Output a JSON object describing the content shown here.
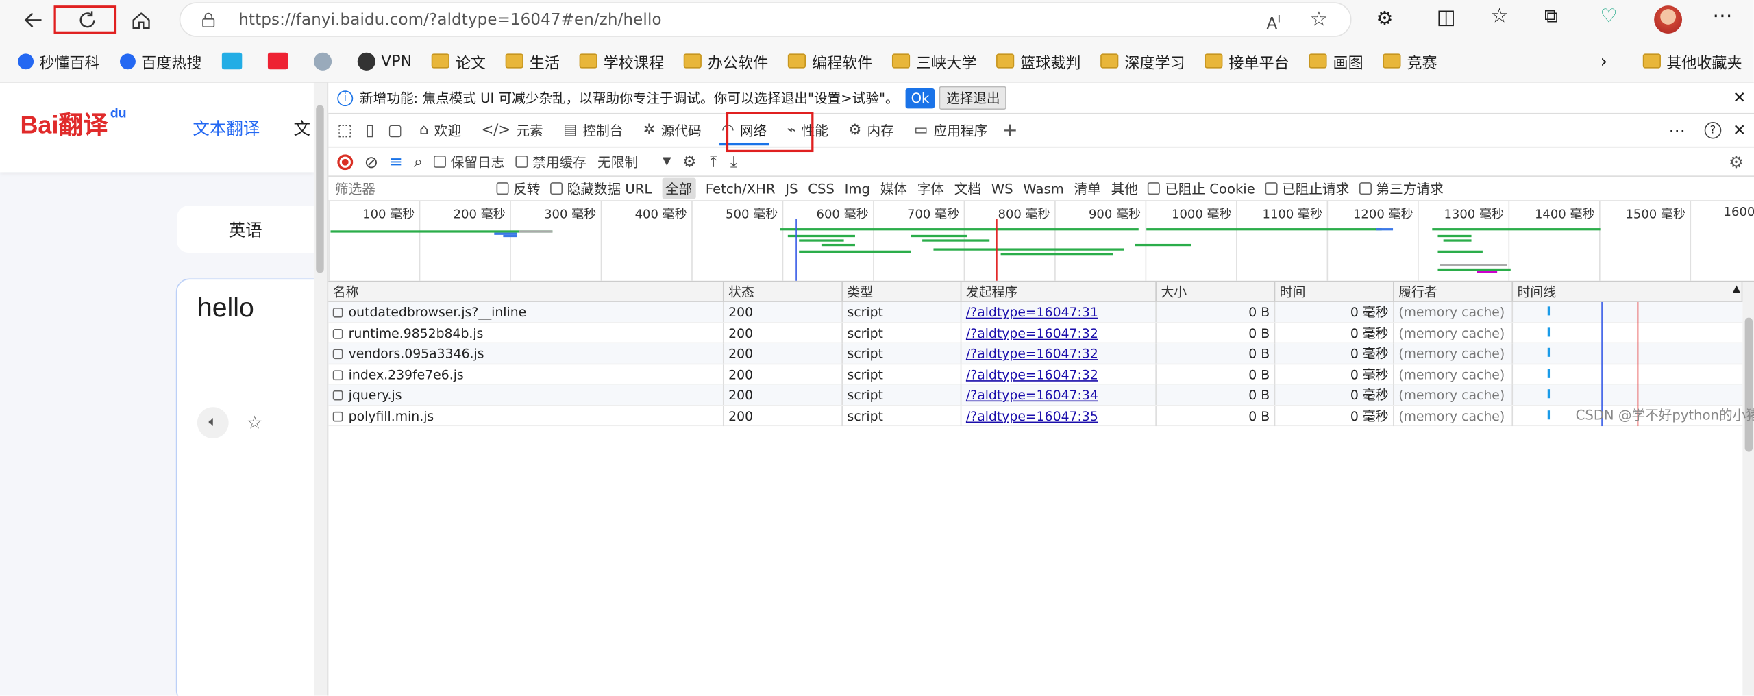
{
  "browser": {
    "url": "https://fanyi.baidu.com/?aldtype=16047#en/zh/hello"
  },
  "bookmarks": [
    {
      "label": "秒懂百科",
      "icon": "baidu-paw-icon"
    },
    {
      "label": "百度热搜",
      "icon": "baidu-paw-icon"
    },
    {
      "label": "",
      "icon": "bilibili-icon"
    },
    {
      "label": "",
      "icon": "toutiao-icon"
    },
    {
      "label": "",
      "icon": "openai-icon"
    },
    {
      "label": "VPN",
      "icon": "vpn-icon"
    },
    {
      "label": "论文",
      "icon": "folder-icon"
    },
    {
      "label": "生活",
      "icon": "folder-icon"
    },
    {
      "label": "学校课程",
      "icon": "folder-icon"
    },
    {
      "label": "办公软件",
      "icon": "folder-icon"
    },
    {
      "label": "编程软件",
      "icon": "folder-icon"
    },
    {
      "label": "三峡大学",
      "icon": "folder-icon"
    },
    {
      "label": "篮球裁判",
      "icon": "folder-icon"
    },
    {
      "label": "深度学习",
      "icon": "folder-icon"
    },
    {
      "label": "接单平台",
      "icon": "folder-icon"
    },
    {
      "label": "画图",
      "icon": "folder-icon"
    },
    {
      "label": "竞赛",
      "icon": "folder-icon"
    }
  ],
  "other_bookmarks": "其他收藏夹",
  "page": {
    "logo": "Bai翻译",
    "logo_du": "du",
    "nav_text_translate": "文本翻译",
    "nav_doc_partial": "文",
    "source_lang": "英语",
    "input_text": "hello"
  },
  "devtools": {
    "infobar": {
      "text": "新增功能: 焦点模式 UI 可减少杂乱，以帮助你专注于调试。你可以选择退出\"设置>试验\"。",
      "ok": "Ok",
      "exit": "选择退出"
    },
    "tabs": [
      {
        "label": "欢迎",
        "icon": "home-icon"
      },
      {
        "label": "元素",
        "icon": "code-icon"
      },
      {
        "label": "控制台",
        "icon": "console-icon"
      },
      {
        "label": "源代码",
        "icon": "bug-icon"
      },
      {
        "label": "网络",
        "icon": "wifi-icon",
        "active": true
      },
      {
        "label": "性能",
        "icon": "performance-icon"
      },
      {
        "label": "内存",
        "icon": "memory-icon"
      },
      {
        "label": "应用程序",
        "icon": "application-icon"
      }
    ],
    "network_toolbar": {
      "preserve_log": "保留日志",
      "disable_cache": "禁用缓存",
      "throttling": "无限制"
    },
    "filter": {
      "placeholder": "筛选器",
      "invert": "反转",
      "hide_data_urls": "隐藏数据 URL",
      "types": [
        "全部",
        "Fetch/XHR",
        "JS",
        "CSS",
        "Img",
        "媒体",
        "字体",
        "文档",
        "WS",
        "Wasm",
        "清单",
        "其他"
      ],
      "blocked_cookies": "已阻止 Cookie",
      "blocked_requests": "已阻止请求",
      "third_party": "第三方请求"
    },
    "overview_ticks": [
      "100 毫秒",
      "200 毫秒",
      "300 毫秒",
      "400 毫秒",
      "500 毫秒",
      "600 毫秒",
      "700 毫秒",
      "800 毫秒",
      "900 毫秒",
      "1000 毫秒",
      "1100 毫秒",
      "1200 毫秒",
      "1300 毫秒",
      "1400 毫秒",
      "1500 毫秒",
      "1600"
    ],
    "columns": [
      "名称",
      "状态",
      "类型",
      "发起程序",
      "大小",
      "时间",
      "履行者",
      "时间线"
    ],
    "rows": [
      {
        "name": "outdatedbrowser.js?__inline",
        "status": "200",
        "type": "script",
        "initiator": "/?aldtype=16047:31",
        "size": "0 B",
        "time": "0 毫秒",
        "fulfilled": "(memory cache)"
      },
      {
        "name": "runtime.9852b84b.js",
        "status": "200",
        "type": "script",
        "initiator": "/?aldtype=16047:32",
        "size": "0 B",
        "time": "0 毫秒",
        "fulfilled": "(memory cache)"
      },
      {
        "name": "vendors.095a3346.js",
        "status": "200",
        "type": "script",
        "initiator": "/?aldtype=16047:32",
        "size": "0 B",
        "time": "0 毫秒",
        "fulfilled": "(memory cache)"
      },
      {
        "name": "index.239fe7e6.js",
        "status": "200",
        "type": "script",
        "initiator": "/?aldtype=16047:32",
        "size": "0 B",
        "time": "0 毫秒",
        "fulfilled": "(memory cache)"
      },
      {
        "name": "jquery.js",
        "status": "200",
        "type": "script",
        "initiator": "/?aldtype=16047:34",
        "size": "0 B",
        "time": "0 毫秒",
        "fulfilled": "(memory cache)"
      },
      {
        "name": "polyfill.min.js",
        "status": "200",
        "type": "script",
        "initiator": "/?aldtype=16047:35",
        "size": "0 B",
        "time": "0 毫秒",
        "fulfilled": "(memory cache)"
      }
    ],
    "watermark": "CSDN @学不好python的小猪"
  }
}
